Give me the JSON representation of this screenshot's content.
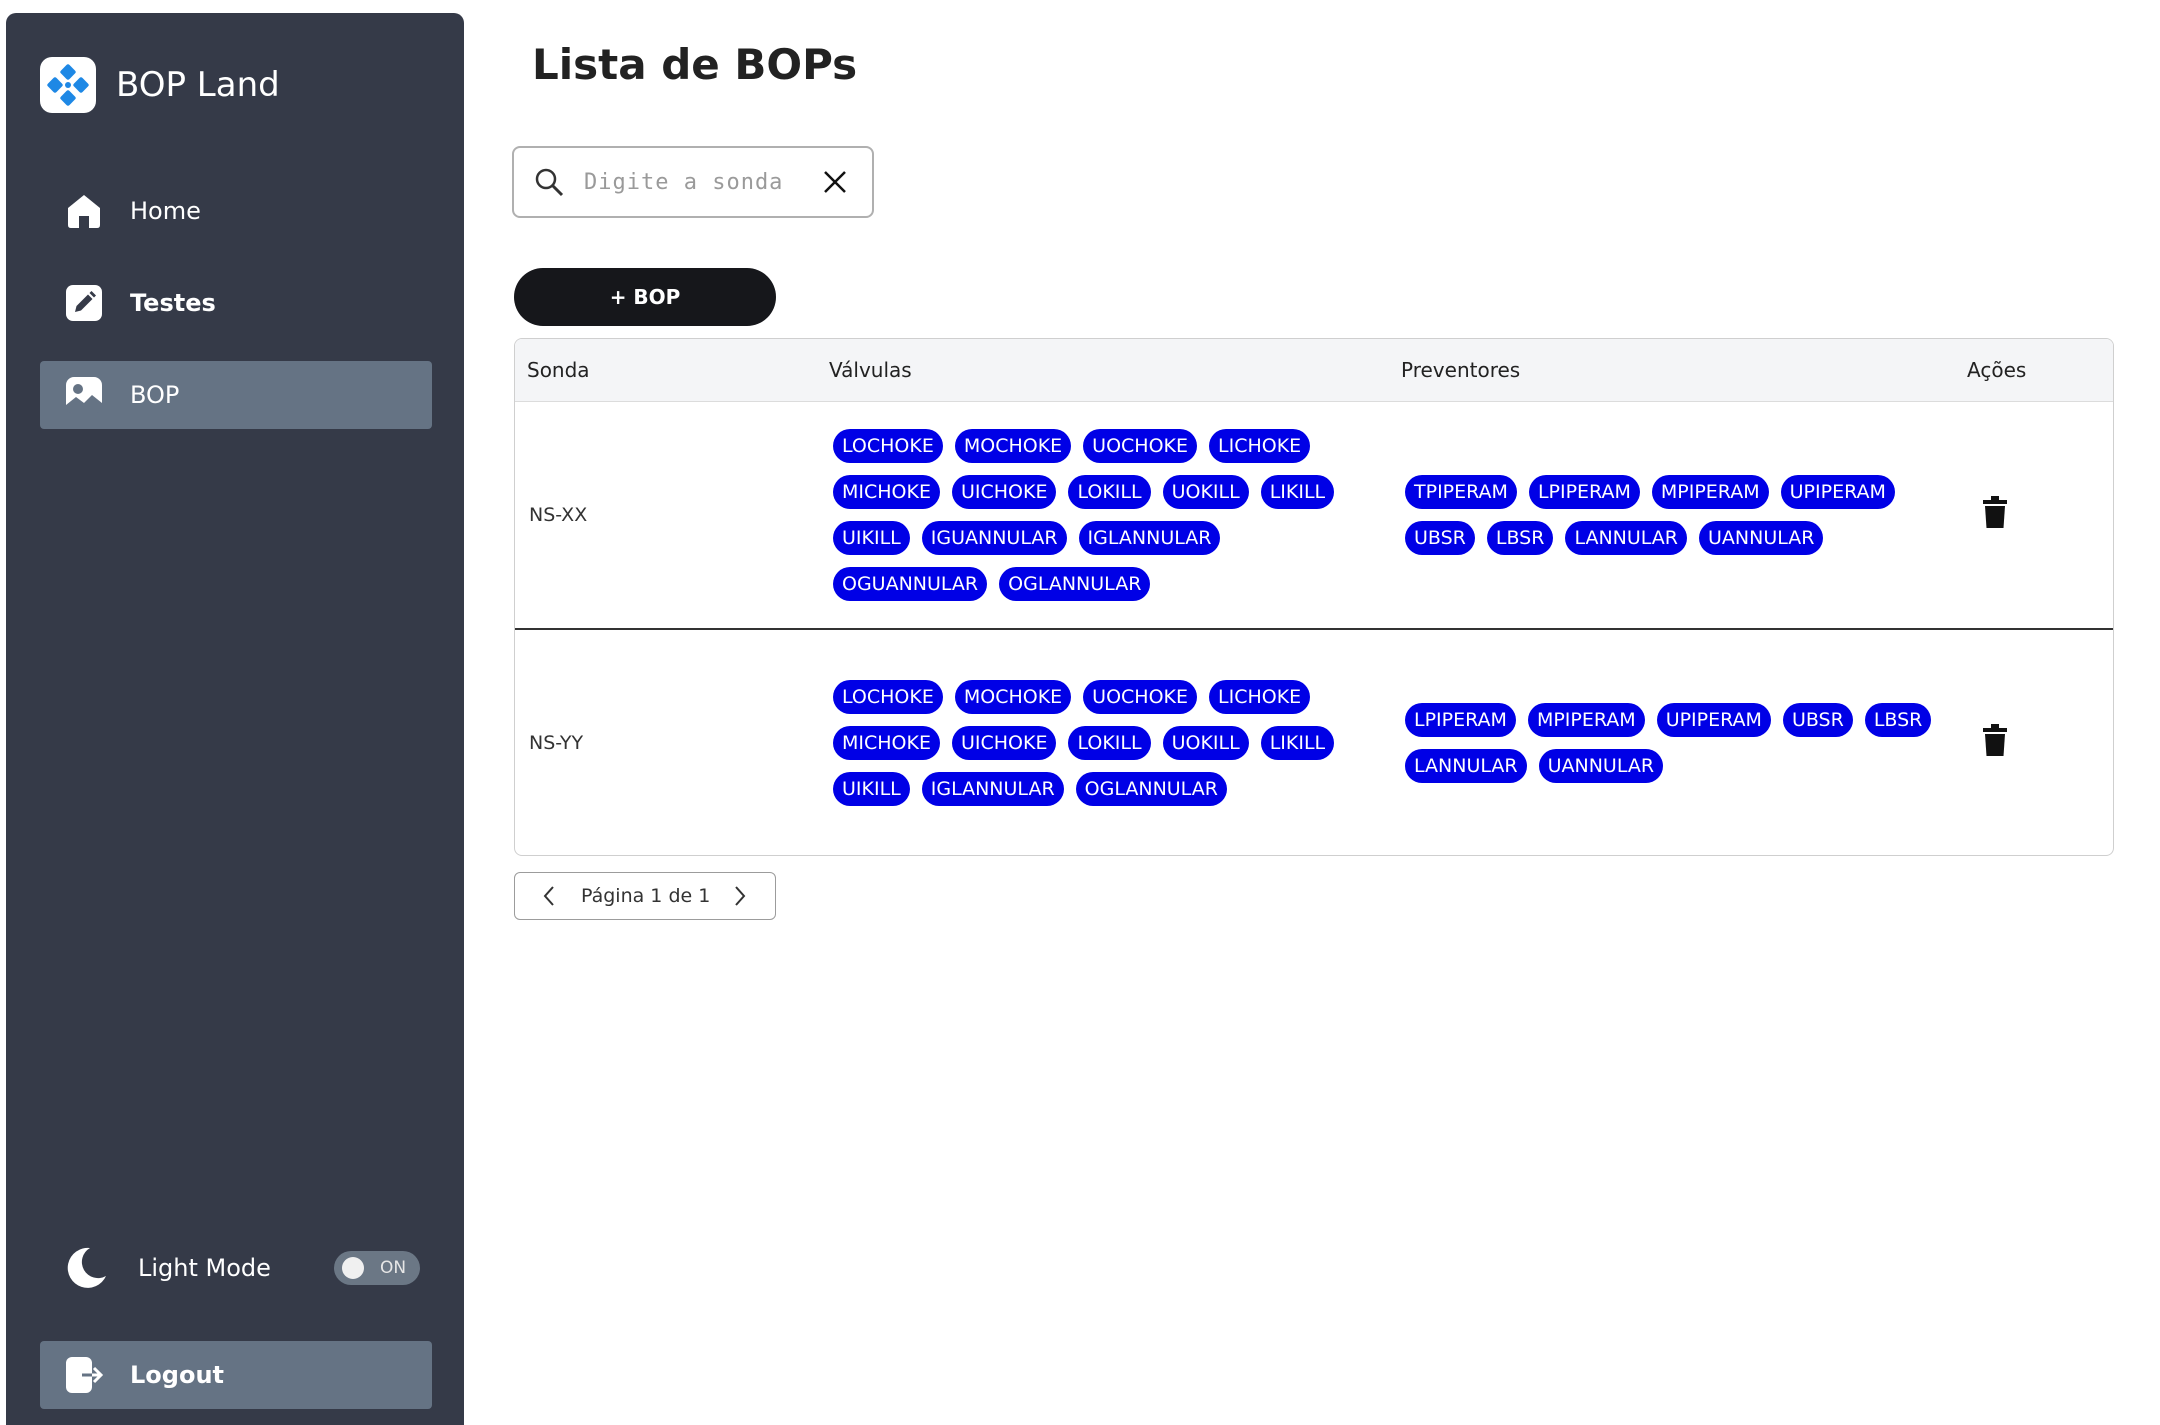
{
  "brand": {
    "name": "BOP Land",
    "logo_icon": "diamond-grid-icon",
    "accent": "#1e88e5"
  },
  "sidebar": {
    "items": [
      {
        "label": "Home",
        "icon": "home-icon"
      },
      {
        "label": "Testes",
        "icon": "edit-icon"
      },
      {
        "label": "BOP",
        "icon": "image-icon",
        "active": true
      }
    ],
    "mode_label": "Light Mode",
    "toggle_text": "ON",
    "logout_label": "Logout"
  },
  "main": {
    "title": "Lista de BOPs",
    "search": {
      "placeholder": "Digite a sonda",
      "value": ""
    },
    "add_button_label": "+ BOP",
    "table": {
      "headers": [
        "Sonda",
        "Válvulas",
        "Preventores",
        "Ações"
      ],
      "rows": [
        {
          "sonda": "NS-XX",
          "valvulas": [
            "LOCHOKE",
            "MOCHOKE",
            "UOCHOKE",
            "LICHOKE",
            "MICHOKE",
            "UICHOKE",
            "LOKILL",
            "UOKILL",
            "LIKILL",
            "UIKILL",
            "IGUANNULAR",
            "IGLANNULAR",
            "OGUANNULAR",
            "OGLANNULAR"
          ],
          "preventores": [
            "TPIPERAM",
            "LPIPERAM",
            "MPIPERAM",
            "UPIPERAM",
            "UBSR",
            "LBSR",
            "LANNULAR",
            "UANNULAR"
          ]
        },
        {
          "sonda": "NS-YY",
          "valvulas": [
            "LOCHOKE",
            "MOCHOKE",
            "UOCHOKE",
            "LICHOKE",
            "MICHOKE",
            "UICHOKE",
            "LOKILL",
            "UOKILL",
            "LIKILL",
            "UIKILL",
            "IGLANNULAR",
            "OGLANNULAR"
          ],
          "preventores": [
            "LPIPERAM",
            "MPIPERAM",
            "UPIPERAM",
            "UBSR",
            "LBSR",
            "LANNULAR",
            "UANNULAR"
          ]
        }
      ]
    },
    "pagination": {
      "text": "Página 1 de 1"
    }
  },
  "colors": {
    "sidebar_bg": "#353a48",
    "active_bg": "#657384",
    "chip_bg": "#0000e6",
    "button_bg": "#16171b"
  }
}
